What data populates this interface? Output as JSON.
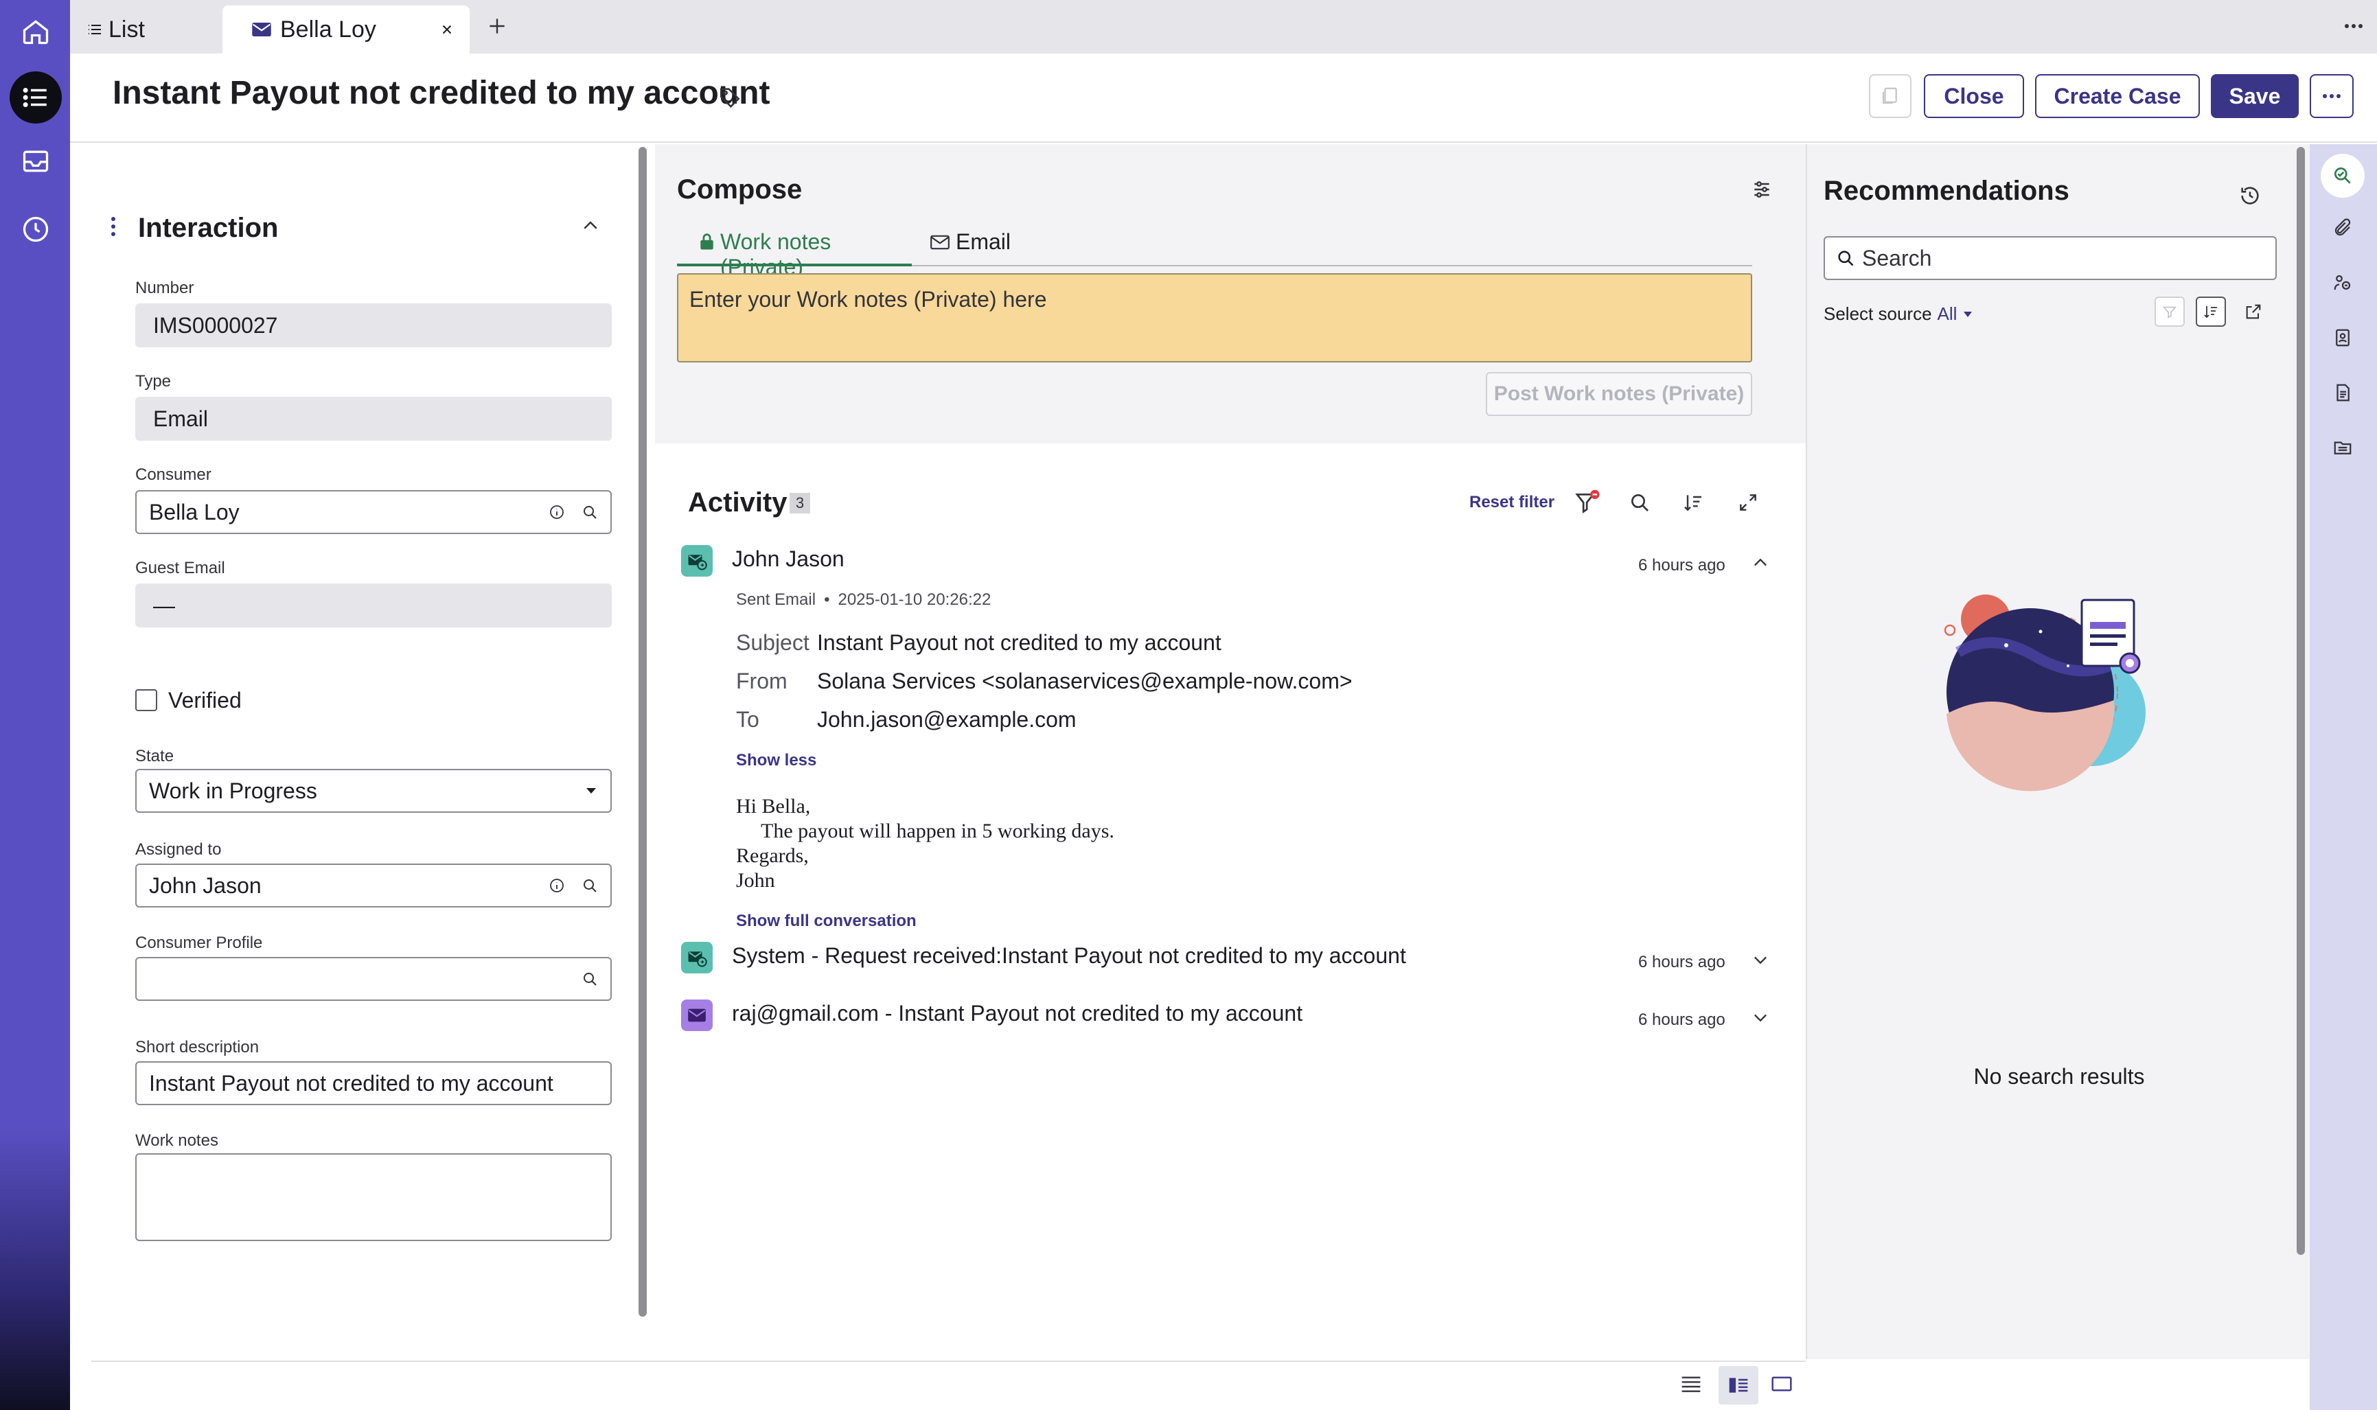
{
  "tabs": {
    "list_label": "List",
    "contact_label": "Bella Loy"
  },
  "header": {
    "title": "Instant Payout not credited to my account",
    "close_label": "Close",
    "create_case_label": "Create Case",
    "save_label": "Save"
  },
  "form": {
    "section_title": "Interaction",
    "number_label": "Number",
    "number_value": "IMS0000027",
    "type_label": "Type",
    "type_value": "Email",
    "consumer_label": "Consumer",
    "consumer_value": "Bella Loy",
    "guest_email_label": "Guest Email",
    "guest_email_value": "—",
    "verified_label": "Verified",
    "state_label": "State",
    "state_value": "Work in Progress",
    "assigned_label": "Assigned to",
    "assigned_value": "John Jason",
    "profile_label": "Consumer Profile",
    "profile_value": "",
    "short_desc_label": "Short description",
    "short_desc_value": "Instant Payout not credited to my account",
    "work_notes_label": "Work notes"
  },
  "compose": {
    "title": "Compose",
    "tab_work_notes": "Work notes (Private)",
    "tab_email": "Email",
    "placeholder": "Enter your Work notes (Private) here",
    "post_label": "Post Work notes (Private)"
  },
  "activity": {
    "title": "Activity",
    "count": "3",
    "reset_filter": "Reset filter",
    "entries": [
      {
        "author": "John Jason",
        "time": "6 hours ago",
        "kind": "Sent Email",
        "datetime": "2025-01-10 20:26:22",
        "subject_label": "Subject",
        "subject": "Instant Payout not credited to my account",
        "from_label": "From",
        "from": "Solana Services <solanaservices@example-now.com>",
        "to_label": "To",
        "to": "John.jason@example.com",
        "show_less": "Show less",
        "body_lines": [
          "Hi Bella,",
          "The payout will happen in 5 working days.",
          "Regards,",
          "John"
        ],
        "show_full": "Show full conversation"
      },
      {
        "author": "System - Request received:Instant Payout not credited to my account",
        "time": "6 hours ago"
      },
      {
        "author": "raj@gmail.com - Instant Payout not credited to my account",
        "time": "6 hours ago"
      }
    ]
  },
  "recommendations": {
    "title": "Recommendations",
    "search_placeholder": "Search",
    "select_source_label": "Select source",
    "select_source_value": "All",
    "no_results": "No search results"
  },
  "colors": {
    "brand": "#3a3586",
    "rail": "#5a4fc2",
    "work_notes_bg": "#f8d99a",
    "work_notes_accent": "#2e7d4f",
    "avatar_teal": "#5bbfb0",
    "avatar_purple": "#a57fe6"
  },
  "icons": [
    "home-icon",
    "list-icon",
    "inbox-icon",
    "clock-icon",
    "mail-icon",
    "tag-icon",
    "lock-icon",
    "search-icon",
    "info-icon",
    "filter-icon",
    "sort-icon",
    "expand-icon",
    "history-icon",
    "paperclip-icon"
  ]
}
